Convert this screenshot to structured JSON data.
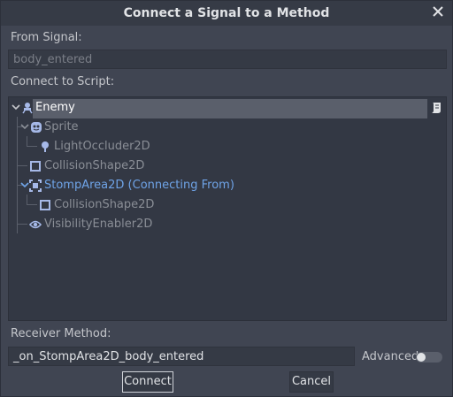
{
  "dialog": {
    "title": "Connect a Signal to a Method",
    "from_signal_label": "From Signal:",
    "signal_value": "body_entered",
    "connect_to_script_label": "Connect to Script:",
    "receiver_label": "Receiver Method:",
    "receiver_value": "_on_StompArea2D_body_entered",
    "advanced_label": "Advanced",
    "advanced_on": false,
    "connect_label": "Connect",
    "cancel_label": "Cancel"
  },
  "tree": [
    {
      "label": "Enemy",
      "icon": "kinematic-body-icon",
      "selected": true,
      "has_script": true
    },
    {
      "label": "Sprite",
      "icon": "sprite-icon"
    },
    {
      "label": "LightOccluder2D",
      "icon": "light-occluder-icon"
    },
    {
      "label": "CollisionShape2D",
      "icon": "collision-shape-icon"
    },
    {
      "label": "StompArea2D (Connecting From)",
      "icon": "area2d-icon",
      "accent": true
    },
    {
      "label": "CollisionShape2D",
      "icon": "collision-shape-icon"
    },
    {
      "label": "VisibilityEnabler2D",
      "icon": "visibility-enabler-icon"
    }
  ],
  "colors": {
    "accent": "#6fa4e8",
    "dim_text": "#8a8e96",
    "node_icon": "#a6b9e8"
  }
}
